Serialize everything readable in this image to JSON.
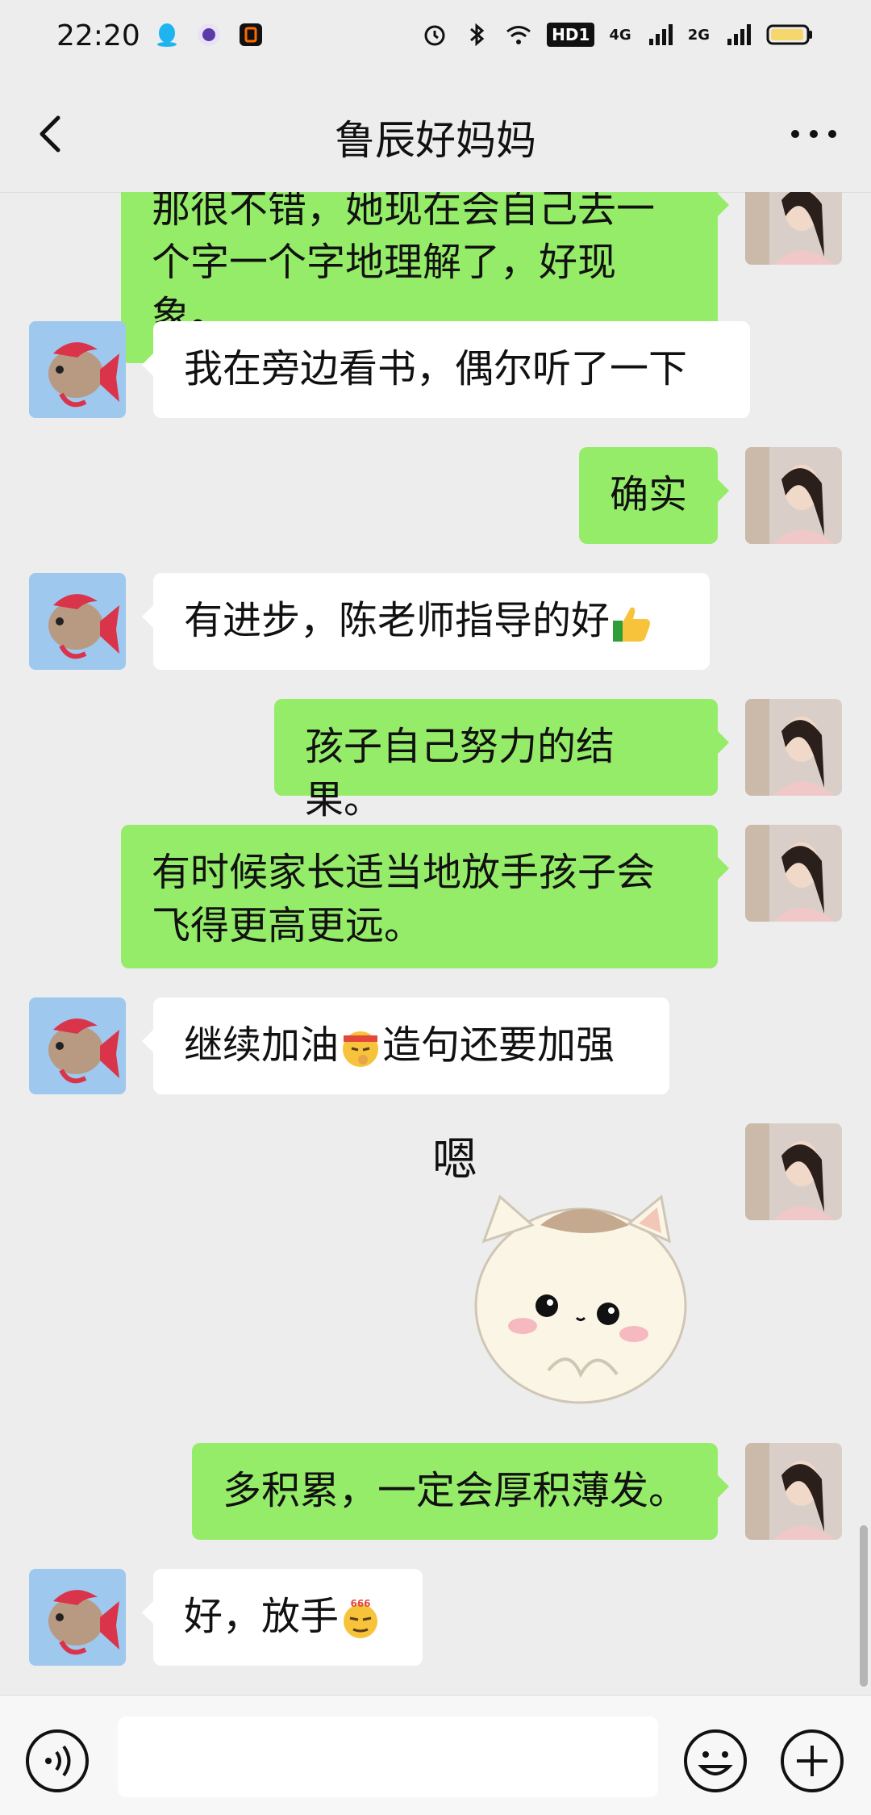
{
  "status_bar": {
    "time": "22:20",
    "icons": [
      "qq-icon",
      "browser-icon",
      "app-icon",
      "alarm-icon",
      "bluetooth-icon",
      "wifi-icon",
      "hd-icon",
      "signal-4g-icon",
      "signal-2g-icon",
      "battery-icon"
    ],
    "hd_label": "HD1",
    "signal_label_4g": "4G",
    "signal_label_2g": "2G"
  },
  "header": {
    "title": "鲁辰好妈妈"
  },
  "messages": [
    {
      "side": "out",
      "text_line1": "那很不错，她现在会自己去一",
      "text_line2": "个字一个字地理解了，好现象。"
    },
    {
      "side": "in",
      "text": "我在旁边看书，偶尔听了一下"
    },
    {
      "side": "out",
      "text": "确实"
    },
    {
      "side": "in",
      "text": "有进步，陈老师指导的好",
      "emoji": "thumbs-up-emoji"
    },
    {
      "side": "out",
      "text": "孩子自己努力的结果。"
    },
    {
      "side": "out",
      "text_line1": "有时候家长适当地放手孩子会",
      "text_line2": "飞得更高更远。"
    },
    {
      "side": "in",
      "text_before": "继续加油",
      "emoji": "fighting-emoji",
      "text_after": "造句还要加强"
    },
    {
      "side": "out",
      "sticker": "cat-sticker",
      "sticker_caption": "嗯"
    },
    {
      "side": "out",
      "text": "多积累，一定会厚积薄发。"
    },
    {
      "side": "in",
      "text": "好，放手",
      "emoji": "666-emoji"
    }
  ],
  "input_bar": {
    "placeholder": ""
  },
  "colors": {
    "background": "#ededed",
    "bubble_out": "#95ec69",
    "bubble_in": "#ffffff"
  }
}
